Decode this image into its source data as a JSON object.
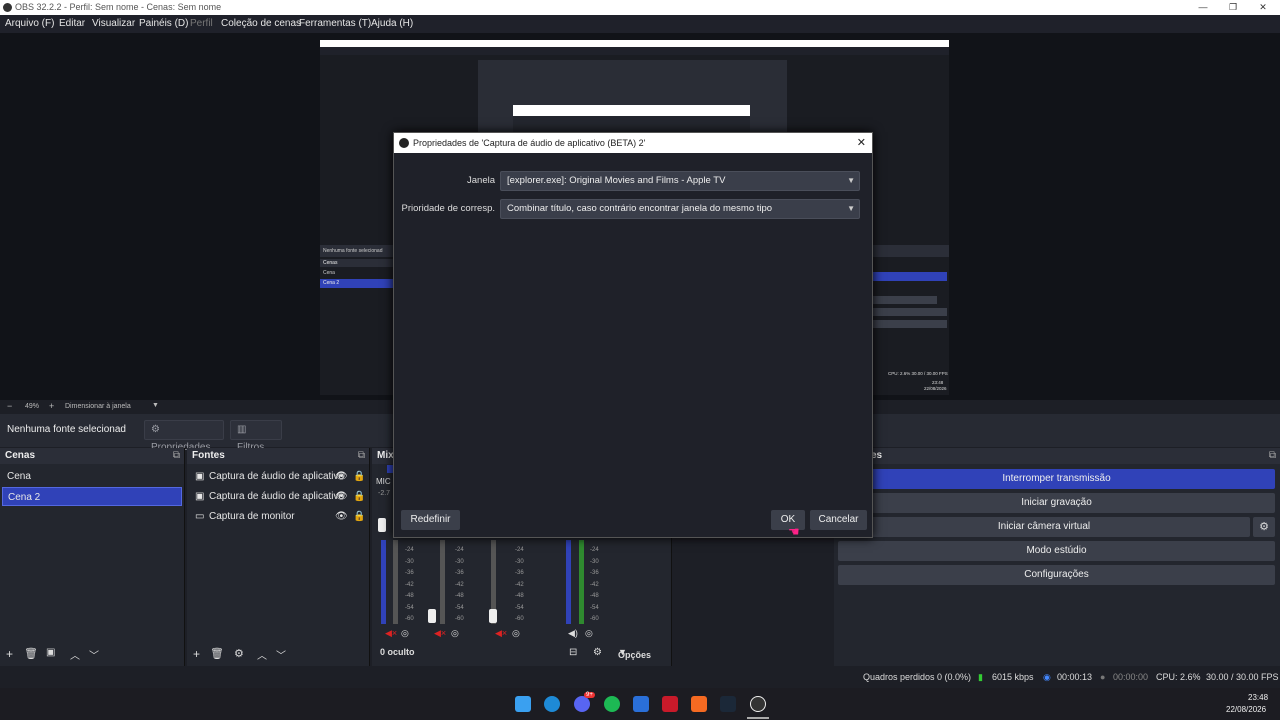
{
  "window": {
    "title": "OBS 32.2.2 - Perfil: Sem nome - Cenas: Sem nome",
    "minimize": "—",
    "maximize": "❐",
    "close": "✕"
  },
  "menu": [
    "Arquivo (F)",
    "Editar",
    "Visualizar",
    "Painéis (D)",
    "Perfil",
    "Coleção de cenas",
    "Ferramentas (T)",
    "Ajuda (H)"
  ],
  "preview": {
    "zoom": "49%",
    "scale_mode": "Dimensionar à janela",
    "nested_none": "Nenhuma fonte selecionad",
    "nested_cenas": "Cenas",
    "nested_items": [
      "Cena",
      "Cena 2"
    ],
    "nested_stats": "CPU: 2.6%   30.00 / 30.00 FPS",
    "nested_time": "23:48",
    "nested_date": "22/08/2026"
  },
  "source_toolbar": {
    "no_source": "Nenhuma fonte selecionad",
    "properties": "Propriedades",
    "filters": "Filtros"
  },
  "scenes": {
    "header": "Cenas",
    "items": [
      "Cena",
      "Cena 2"
    ],
    "selected": 1
  },
  "sources": {
    "header": "Fontes",
    "items": [
      "Captura de áudio de aplicativo",
      "Captura de áudio de aplicativo",
      "Captura de monitor"
    ]
  },
  "mixer": {
    "header": "Mix",
    "hidden": "0 oculto",
    "options": "Opções",
    "label_mic": "MIC",
    "db_value": "-2.7",
    "scale": [
      "-24",
      "-30",
      "-36",
      "-42",
      "-48",
      "-54",
      "-60"
    ]
  },
  "controls": {
    "header": "es",
    "buttons": [
      "Interromper transmissão",
      "Iniciar gravação",
      "Iniciar câmera virtual",
      "Modo estúdio",
      "Configurações"
    ],
    "active_index": 0
  },
  "status": {
    "dropped": "Quadros perdidos 0 (0.0%)",
    "bitrate": "6015 kbps",
    "stream_time": "00:00:13",
    "rec_time": "00:00:00",
    "cpu": "CPU: 2.6%",
    "fps": "30.00 / 30.00 FPS"
  },
  "taskbar": {
    "time": "23:48",
    "date": "22/08/2026",
    "discord_badge": "9+"
  },
  "dialog": {
    "title": "Propriedades de 'Captura de áudio de aplicativo (BETA) 2'",
    "window_label": "Janela",
    "window_value": "[explorer.exe]: Original Movies and Films - Apple TV",
    "priority_label": "Prioridade de corresp.",
    "priority_value": "Combinar título, caso contrário encontrar janela do mesmo tipo",
    "reset": "Redefinir",
    "ok": "OK",
    "cancel": "Cancelar"
  },
  "colors": {
    "accent": "#3042b8",
    "bg": "#1d1f26",
    "dock": "#23262e"
  }
}
